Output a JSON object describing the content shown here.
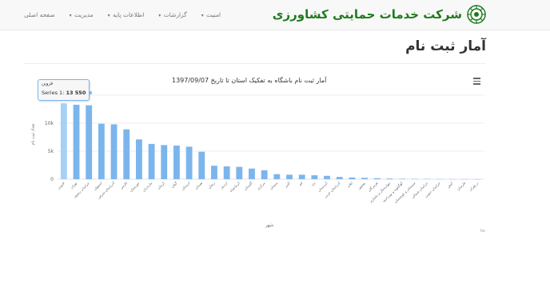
{
  "nav": {
    "items": [
      {
        "label": "صفحه اصلی",
        "dropdown": false
      },
      {
        "label": "مدیریت",
        "dropdown": true
      },
      {
        "label": "اطلاعات پایه",
        "dropdown": true
      },
      {
        "label": "گزارشات",
        "dropdown": true
      },
      {
        "label": "امنیت",
        "dropdown": true
      }
    ]
  },
  "brand": {
    "name": "شرکت خدمات حمایتی کشاورزی",
    "color": "#1f7a1f"
  },
  "page": {
    "title": "آمار ثبت نام"
  },
  "chart_data": {
    "type": "bar",
    "title": "آمار ثبت نام باشگاه به تفکیک استان تا تاریخ 1397/09/07",
    "xlabel": "شهر",
    "ylabel": "تعداد ثبت نام",
    "ylim": [
      0,
      15000
    ],
    "y_ticks": [
      "0",
      "5k",
      "10k"
    ],
    "categories": [
      "قزوین",
      "تهران",
      "خراسان رضوی",
      "اصفهان",
      "آذربایجان شرقی",
      "فارس",
      "خوزستان",
      "مازندران",
      "کرمان",
      "گیلان",
      "لرستان",
      "همدان",
      "زنجان",
      "اردبیل",
      "کرمانشاه",
      "گلستان",
      "مرکزی",
      "سمنان",
      "البرز",
      "قم",
      "یزد",
      "کردستان",
      "آذربایجان غربی",
      "ایلام",
      "بوشهر",
      "هرمزگان",
      "چهارمحال و بختیاری",
      "کهگیلویه و بویراحمد",
      "سیستان و بلوچستان",
      "خراسان شمالی",
      "خراسان جنوبی",
      "کیش",
      "فارسان",
      "ر_تهران"
    ],
    "series": [
      {
        "name": "Series 1",
        "color": "#7cb5ec",
        "values": [
          13550,
          13300,
          13200,
          9900,
          9800,
          8900,
          7100,
          6300,
          6100,
          6000,
          5800,
          4900,
          2400,
          2300,
          2200,
          1900,
          1600,
          900,
          800,
          800,
          700,
          600,
          400,
          300,
          250,
          180,
          120,
          80,
          60,
          40,
          30,
          20,
          10,
          5
        ]
      }
    ],
    "highlight_index": 0,
    "tooltip": {
      "category": "قزوین",
      "series": "Series 1",
      "value": "13 550"
    },
    "credit": "hs"
  }
}
